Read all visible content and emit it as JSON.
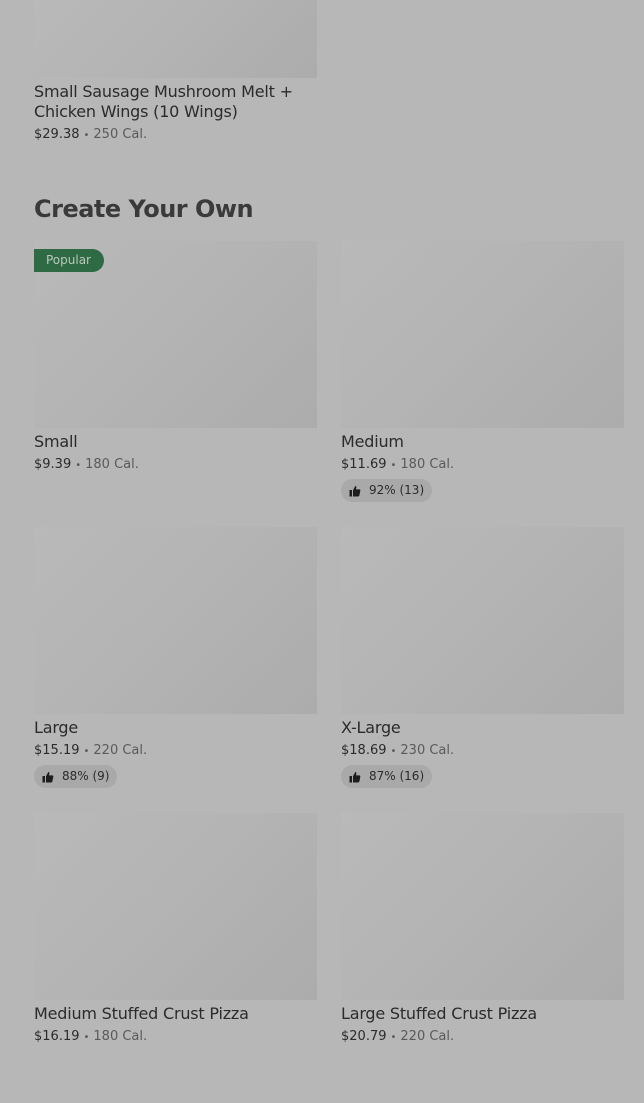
{
  "top_item": {
    "title": "Small Sausage Mushroom Melt + Chicken Wings (10 Wings)",
    "price": "$29.38",
    "calories": "250 Cal."
  },
  "section": {
    "heading": "Create Your Own",
    "items": [
      {
        "title": "Small",
        "price": "$9.39",
        "calories": "180 Cal.",
        "badge": "Popular"
      },
      {
        "title": "Medium",
        "price": "$11.69",
        "calories": "180 Cal.",
        "rating": "92% (13)"
      },
      {
        "title": "Large",
        "price": "$15.19",
        "calories": "220 Cal.",
        "rating": "88% (9)"
      },
      {
        "title": "X-Large",
        "price": "$18.69",
        "calories": "230 Cal.",
        "rating": "87% (16)"
      },
      {
        "title": "Medium Stuffed Crust Pizza",
        "price": "$16.19",
        "calories": "180 Cal."
      },
      {
        "title": "Large Stuffed Crust Pizza",
        "price": "$20.79",
        "calories": "220 Cal."
      }
    ]
  },
  "separator": "•",
  "icons": {
    "rating": "thumbs-up-icon"
  },
  "colors": {
    "badge_bg": "#2e6a44",
    "overlay_bg": "#b7b7b7"
  }
}
